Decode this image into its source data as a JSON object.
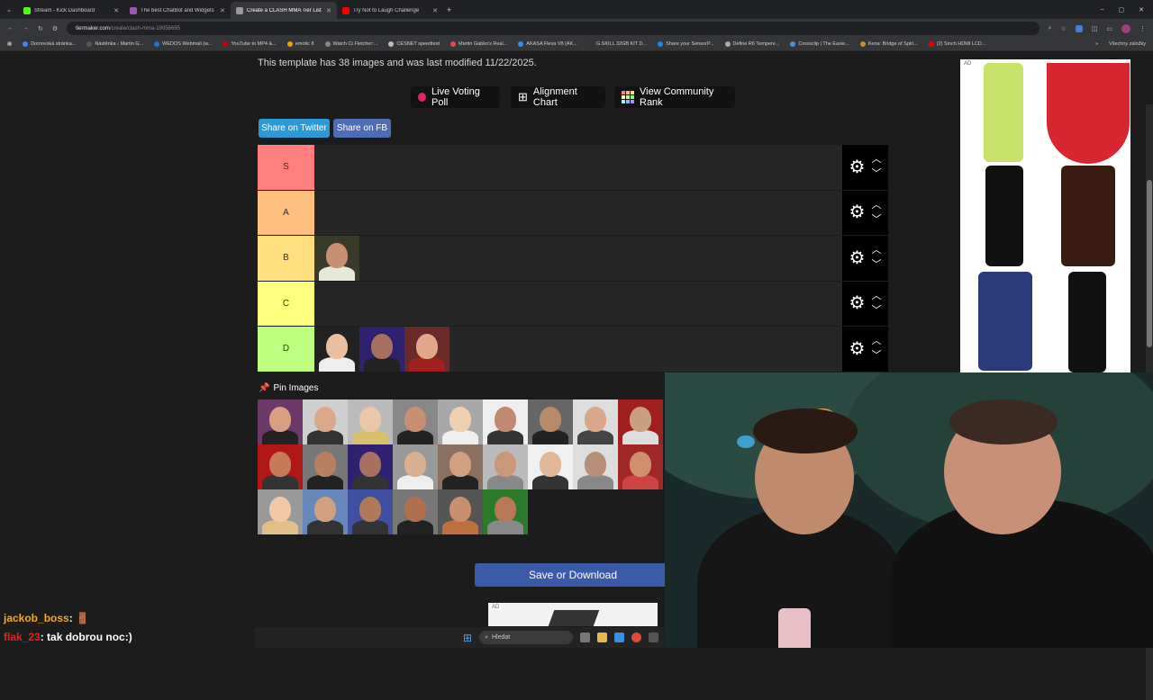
{
  "browser": {
    "tabs": [
      {
        "title": "Stream - Kick Dashboard",
        "color": "#53fc18",
        "active": false
      },
      {
        "title": "The best ChatBot and Widgets",
        "color": "#9b59b6",
        "active": false
      },
      {
        "title": "Create a CLASH MMA Tier List",
        "color": "#999999",
        "active": true
      },
      {
        "title": "Try Not to Laugh Challenge",
        "color": "#ff0000",
        "active": false
      }
    ],
    "url_host": "tiermaker.com",
    "url_path": "/create/clash-mma-19058695",
    "bookmarks": [
      "Domovská stránka...",
      "Nástěnka ‹ Martin G...",
      "WEDOS Webmail (w...",
      "YouTube to MP4 &...",
      "emotic 8",
      "Watch Ct Fletcher:...",
      "CESNET speedtest",
      "Martin Gabko's Real...",
      "AKASA Flexa V8 (AK...",
      "G.SKILL 32GB KIT D...",
      "Share your SensorP...",
      "Define R6 Tempere...",
      "Crossclip | The Easie...",
      "Kena: Bridge of Spiri...",
      "(2) Sinch HDMI LCD..."
    ],
    "bookmarks_folder": "Všechny záložky"
  },
  "page": {
    "info_text": "This template has 38 images and was last modified 11/22/2025.",
    "features": {
      "live_voting": "Live Voting Poll",
      "alignment": "Alignment Chart",
      "community_rank": "View Community Rank"
    },
    "share": {
      "twitter": "Share on Twitter",
      "fb": "Share on FB"
    },
    "tiers": [
      {
        "label": "S",
        "color": "#ff7f7f",
        "count": 0
      },
      {
        "label": "A",
        "color": "#ffbf7f",
        "count": 0
      },
      {
        "label": "B",
        "color": "#ffdf7f",
        "count": 1
      },
      {
        "label": "C",
        "color": "#ffff7f",
        "count": 0
      },
      {
        "label": "D",
        "color": "#bfff7f",
        "count": 3
      }
    ],
    "pin_images_label": "Pin Images",
    "pool_count": 24,
    "save_button": "Save or Download",
    "ad_label": "AD"
  },
  "chat": [
    {
      "user": "jackob_boss",
      "user_color": "#f5a623",
      "message": ": 🚪"
    },
    {
      "user": "flak_23",
      "user_color": "#e02020",
      "message": ": tak dobrou noc:)"
    }
  ],
  "taskbar": {
    "search_placeholder": "Hledat"
  }
}
